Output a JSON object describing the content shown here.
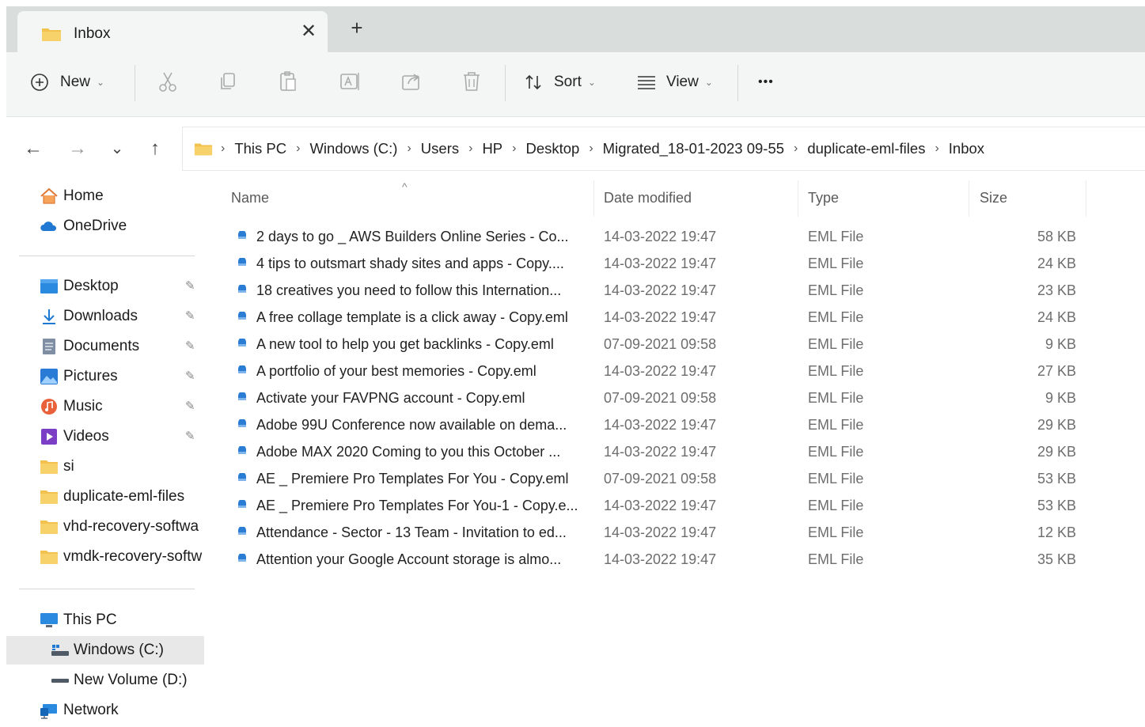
{
  "tab": {
    "title": "Inbox",
    "close_glyph": "✕",
    "new_tab_glyph": "+"
  },
  "toolbar": {
    "new_label": "New",
    "sort_label": "Sort",
    "view_label": "View",
    "more_glyph": "•••",
    "icons": [
      "new-icon",
      "cut-icon",
      "copy-icon",
      "paste-icon",
      "rename-icon",
      "share-icon",
      "delete-icon",
      "sort-icon",
      "view-icon",
      "more-icon"
    ]
  },
  "nav": {
    "back": "←",
    "forward": "→",
    "recent": "⌄",
    "up": "↑"
  },
  "breadcrumb": [
    "This PC",
    "Windows (C:)",
    "Users",
    "HP",
    "Desktop",
    "Migrated_18-01-2023 09-55",
    "duplicate-eml-files",
    "Inbox"
  ],
  "sidebar": {
    "quick": [
      {
        "label": "Home",
        "icon": "home-icon"
      },
      {
        "label": "OneDrive",
        "icon": "cloud-icon"
      }
    ],
    "pinned": [
      {
        "label": "Desktop",
        "icon": "desktop-icon",
        "pinned": true
      },
      {
        "label": "Downloads",
        "icon": "download-icon",
        "pinned": true
      },
      {
        "label": "Documents",
        "icon": "document-icon",
        "pinned": true
      },
      {
        "label": "Pictures",
        "icon": "picture-icon",
        "pinned": true
      },
      {
        "label": "Music",
        "icon": "music-icon",
        "pinned": true
      },
      {
        "label": "Videos",
        "icon": "video-icon",
        "pinned": true
      },
      {
        "label": "si",
        "icon": "folder-icon",
        "pinned": false
      },
      {
        "label": "duplicate-eml-files",
        "icon": "folder-icon",
        "pinned": false
      },
      {
        "label": "vhd-recovery-softwa",
        "icon": "folder-icon",
        "pinned": false
      },
      {
        "label": "vmdk-recovery-softw",
        "icon": "folder-icon",
        "pinned": false
      }
    ],
    "devices": [
      {
        "label": "This PC",
        "icon": "computer-icon"
      },
      {
        "label": "Windows (C:)",
        "icon": "drive-icon",
        "selected": true
      },
      {
        "label": "New Volume (D:)",
        "icon": "drive-icon"
      },
      {
        "label": "Network",
        "icon": "network-icon"
      }
    ],
    "pin_glyph": "📌"
  },
  "columns": {
    "name": "Name",
    "date": "Date modified",
    "type": "Type",
    "size": "Size",
    "sort_indicator": "^"
  },
  "files": [
    {
      "name": "2 days to go _ AWS Builders Online Series - Co...",
      "date": "14-03-2022 19:47",
      "type": "EML File",
      "size": "58 KB"
    },
    {
      "name": "4 tips to outsmart shady sites and apps - Copy....",
      "date": "14-03-2022 19:47",
      "type": "EML File",
      "size": "24 KB"
    },
    {
      "name": "18 creatives you need to follow this Internation...",
      "date": "14-03-2022 19:47",
      "type": "EML File",
      "size": "23 KB"
    },
    {
      "name": "A free collage template is a click away - Copy.eml",
      "date": "14-03-2022 19:47",
      "type": "EML File",
      "size": "24 KB"
    },
    {
      "name": "A new tool to help you get backlinks - Copy.eml",
      "date": "07-09-2021 09:58",
      "type": "EML File",
      "size": "9 KB"
    },
    {
      "name": "A portfolio of your best memories - Copy.eml",
      "date": "14-03-2022 19:47",
      "type": "EML File",
      "size": "27 KB"
    },
    {
      "name": "Activate your FAVPNG account - Copy.eml",
      "date": "07-09-2021 09:58",
      "type": "EML File",
      "size": "9 KB"
    },
    {
      "name": "Adobe 99U Conference now available on dema...",
      "date": "14-03-2022 19:47",
      "type": "EML File",
      "size": "29 KB"
    },
    {
      "name": "Adobe MAX 2020 Coming to you this October ...",
      "date": "14-03-2022 19:47",
      "type": "EML File",
      "size": "29 KB"
    },
    {
      "name": "AE _ Premiere Pro Templates For You - Copy.eml",
      "date": "07-09-2021 09:58",
      "type": "EML File",
      "size": "53 KB"
    },
    {
      "name": "AE _ Premiere Pro Templates For You-1 - Copy.e...",
      "date": "14-03-2022 19:47",
      "type": "EML File",
      "size": "53 KB"
    },
    {
      "name": "Attendance - Sector - 13 Team - Invitation to ed...",
      "date": "14-03-2022 19:47",
      "type": "EML File",
      "size": "12 KB"
    },
    {
      "name": "Attention your Google Account storage is almo...",
      "date": "14-03-2022 19:47",
      "type": "EML File",
      "size": "35 KB"
    }
  ],
  "colors": {
    "tabstrip": "#d9dedd",
    "toolbar": "#f4f6f6",
    "folder": "#f2c14e",
    "accent": "#2b7cd3",
    "selected": "#e8e8e8"
  }
}
